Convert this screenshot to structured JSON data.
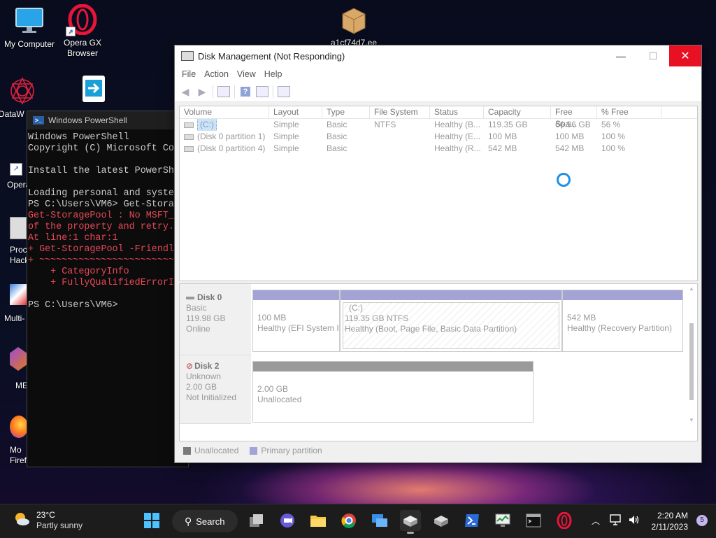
{
  "desktop": {
    "icons": [
      {
        "label": "My Computer"
      },
      {
        "label": "Opera GX Browser"
      },
      {
        "label": "DataW"
      },
      {
        "label": "Opera"
      },
      {
        "label": "Proc Hack"
      },
      {
        "label": "Multi-"
      },
      {
        "label": "ME"
      },
      {
        "label": "Mo Firefox"
      },
      {
        "label": "a1cf74d7.ee"
      }
    ]
  },
  "powershell": {
    "title": "Windows PowerShell",
    "lines": [
      {
        "text": "Windows PowerShell",
        "type": "normal"
      },
      {
        "text": "Copyright (C) Microsoft Cor",
        "type": "normal"
      },
      {
        "text": "",
        "type": "blank"
      },
      {
        "text": "Install the latest PowerShe",
        "type": "normal"
      },
      {
        "text": "",
        "type": "blank"
      },
      {
        "text": "Loading personal and syster",
        "type": "normal"
      },
      {
        "text": "PS C:\\Users\\VM6> Get-Storag",
        "type": "normal"
      },
      {
        "text": "Get-StoragePool : No MSFT_S",
        "type": "err"
      },
      {
        "text": "of the property and retry.",
        "type": "err"
      },
      {
        "text": "At line:1 char:1",
        "type": "err"
      },
      {
        "text": "+ Get-StoragePool -Friendly",
        "type": "err"
      },
      {
        "text": "+ ~~~~~~~~~~~~~~~~~~~~~~~~~~",
        "type": "err"
      },
      {
        "text": "    + CategoryInfo",
        "type": "err"
      },
      {
        "text": "    + FullyQualifiedErrorIc",
        "type": "err"
      },
      {
        "text": "",
        "type": "blank"
      },
      {
        "text": "PS C:\\Users\\VM6>",
        "type": "normal"
      }
    ]
  },
  "disk_management": {
    "title": "Disk Management (Not Responding)",
    "menu": [
      "File",
      "Action",
      "View",
      "Help"
    ],
    "columns": [
      "Volume",
      "Layout",
      "Type",
      "File System",
      "Status",
      "Capacity",
      "Free Spa...",
      "% Free"
    ],
    "volumes": [
      [
        "(C:)",
        "Simple",
        "Basic",
        "NTFS",
        "Healthy (B...",
        "119.35 GB",
        "66.96 GB",
        "56 %"
      ],
      [
        "(Disk 0 partition 1)",
        "Simple",
        "Basic",
        "",
        "Healthy (E...",
        "100 MB",
        "100 MB",
        "100 %"
      ],
      [
        "(Disk 0 partition 4)",
        "Simple",
        "Basic",
        "",
        "Healthy (R...",
        "542 MB",
        "542 MB",
        "100 %"
      ]
    ],
    "disks": [
      {
        "name": "Disk 0",
        "type": "Basic",
        "size": "119.98 GB",
        "state": "Online",
        "partitions": [
          {
            "title": "",
            "line1": "100 MB",
            "line2": "Healthy (EFI System I"
          },
          {
            "title": "(C:)",
            "line1": "119.35 GB NTFS",
            "line2": "Healthy (Boot, Page File, Basic Data Partition)"
          },
          {
            "title": "",
            "line1": "542 MB",
            "line2": "Healthy (Recovery Partition)"
          }
        ]
      },
      {
        "name": "Disk 2",
        "type": "Unknown",
        "size": "2.00 GB",
        "state": "Not Initialized",
        "partitions": [
          {
            "title": "",
            "line1": "2.00 GB",
            "line2": "Unallocated"
          }
        ]
      }
    ],
    "legend": [
      {
        "label": "Unallocated",
        "color": "#7a7a7a"
      },
      {
        "label": "Primary partition",
        "color": "#a3a3d6"
      }
    ],
    "colors": {
      "primary_bar": "#a3a3d6",
      "unallocated_bar": "#9a9a9a"
    }
  },
  "taskbar": {
    "weather_temp": "23°C",
    "weather_desc": "Partly sunny",
    "search_label": "Search",
    "time": "2:20 AM",
    "date": "2/11/2023",
    "notification_count": "5"
  }
}
